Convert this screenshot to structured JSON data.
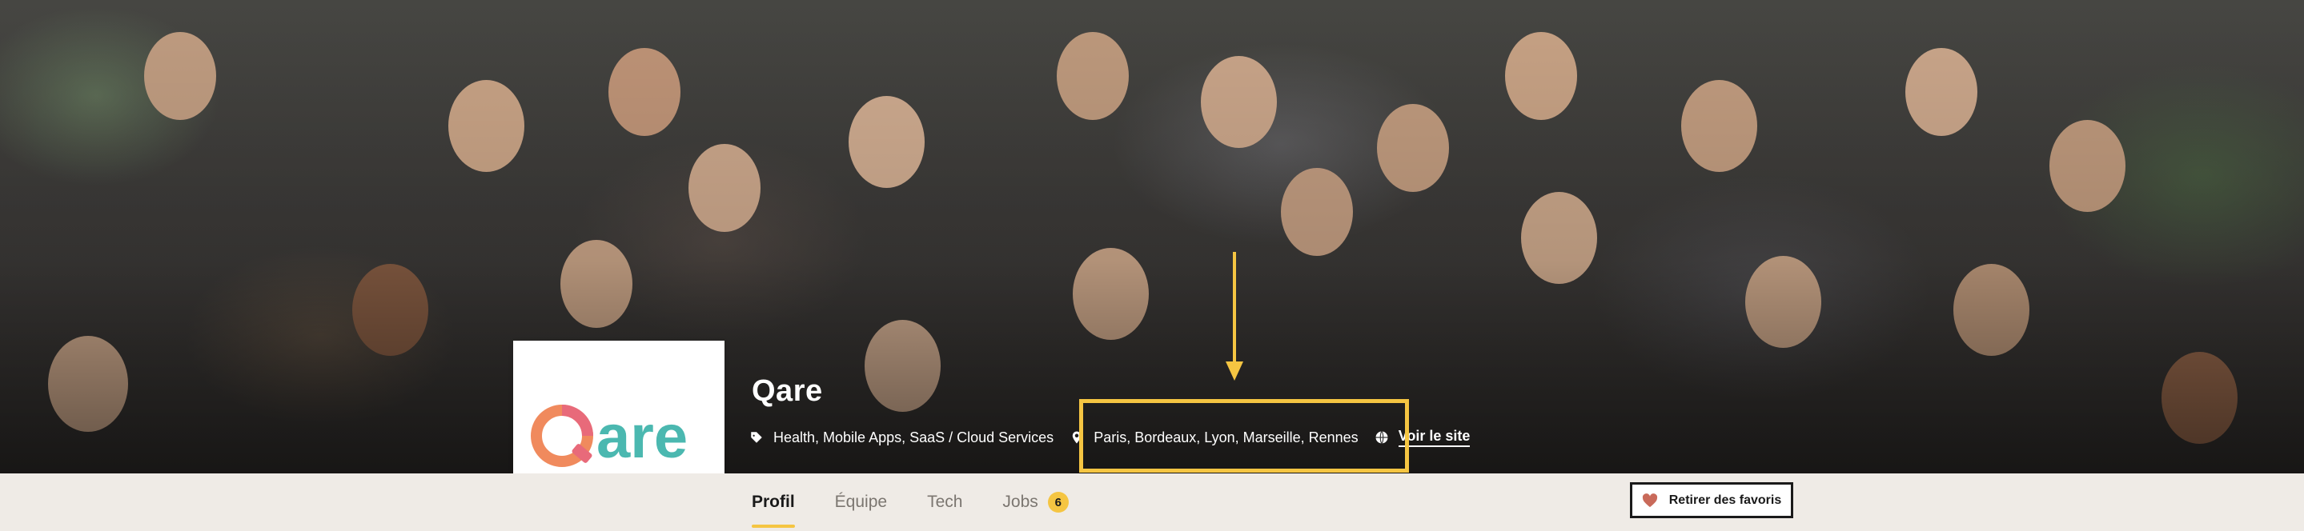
{
  "company": {
    "name": "Qare",
    "logo_text": "Qare",
    "logo_colors": {
      "q_orange": "#f08a5d",
      "q_pink": "#e86a7a",
      "teal": "#4bb8b0"
    }
  },
  "meta": {
    "sectors": "Health, Mobile Apps, SaaS / Cloud Services",
    "location": "Paris, Bordeaux, Lyon, Marseille, Rennes",
    "website_label": "Voir le site"
  },
  "tabs": [
    {
      "label": "Profil",
      "active": true
    },
    {
      "label": "Équipe",
      "active": false
    },
    {
      "label": "Tech",
      "active": false
    },
    {
      "label": "Jobs",
      "active": false,
      "badge": "6"
    }
  ],
  "favorite_button": {
    "label": "Retirer des favoris",
    "icon": "heart-icon"
  },
  "colors": {
    "accent": "#f5c542",
    "heart": "#c96a5a",
    "tabbar_bg": "#efebe6"
  },
  "icons": {
    "sector": "tag-icon",
    "location": "map-pin-icon",
    "website": "globe-icon"
  }
}
